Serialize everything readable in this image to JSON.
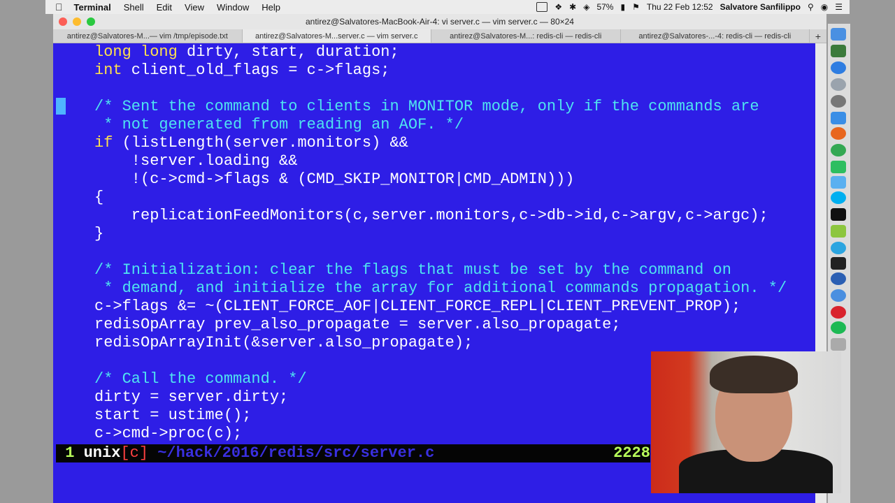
{
  "menubar": {
    "apple": "",
    "items": [
      "Terminal",
      "Shell",
      "Edit",
      "View",
      "Window",
      "Help"
    ],
    "battery": "57%",
    "datetime": "Thu 22 Feb  12:52",
    "user": "Salvatore Sanfilippo"
  },
  "window": {
    "title": "antirez@Salvatores-MacBook-Air-4: vi server.c — vim server.c — 80×24",
    "tabs": [
      "antirez@Salvatores-M...— vim /tmp/episode.txt",
      "antirez@Salvatores-M...server.c — vim server.c",
      "antirez@Salvatores-M...: redis-cli — redis-cli",
      "antirez@Salvatores-...-4: redis-cli — redis-cli"
    ],
    "active_tab": 1,
    "new_tab": "+"
  },
  "code": {
    "l1_kw": "long long",
    "l1_rest": " dirty, start, duration;",
    "l2_kw": "int",
    "l2_rest": " client_old_flags = c->flags;",
    "l3": "/* Sent the command to clients in MONITOR mode, only if the commands are",
    "l4": " * not generated from reading an AOF. */",
    "l5_kw": "if",
    "l5_rest": " (listLength(server.monitors) &&",
    "l6": "    !server.loading &&",
    "l7": "    !(c->cmd->flags & (CMD_SKIP_MONITOR|CMD_ADMIN)))",
    "l8": "{",
    "l9": "    replicationFeedMonitors(c,server.monitors,c->db->id,c->argv,c->argc);",
    "l10": "}",
    "l11": "/* Initialization: clear the flags that must be set by the command on",
    "l12": " * demand, and initialize the array for additional commands propagation. */",
    "l13": "c->flags &= ~(CLIENT_FORCE_AOF|CLIENT_FORCE_REPL|CLIENT_PREVENT_PROP);",
    "l14": "redisOpArray prev_also_propagate = server.also_propagate;",
    "l15": "redisOpArrayInit(&server.also_propagate);",
    "l16": "/* Call the command. */",
    "l17": "dirty = server.dirty;",
    "l18": "start = ustime();",
    "l19": "c->cmd->proc(c);"
  },
  "status": {
    "buffer": "1",
    "format": "unix",
    "lang": "[c]",
    "path": "~/hack/2016/redis/src/server.c",
    "line": "2228"
  },
  "colors": {
    "editor_bg": "#2e1ee6",
    "keyword": "#ffe14d",
    "comment": "#4fe4f0",
    "text": "#ffffff"
  }
}
